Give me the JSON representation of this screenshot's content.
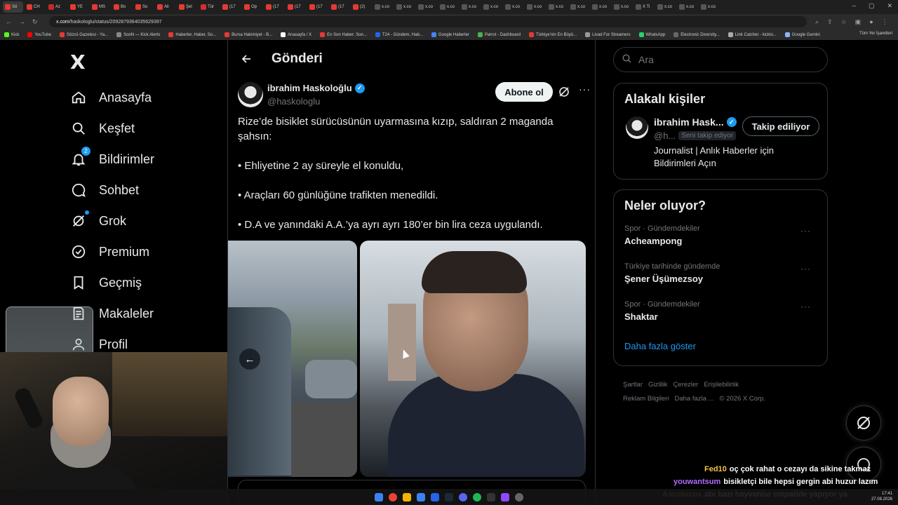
{
  "browser": {
    "tab_labels": [
      "Sö",
      "CH",
      "Az",
      "YE",
      "MS",
      "Bo",
      "So",
      "Ali",
      "Şel",
      "Tür",
      "(17",
      "Op",
      "(17",
      "(17",
      "(17",
      "(17",
      "(2)",
      "x.co",
      "x.co",
      "x.co",
      "x.co",
      "x.co",
      "x.co",
      "x.co",
      "x.co",
      "x.co",
      "x.co",
      "x.co",
      "x.co",
      "X Ti",
      "x.co",
      "x.co",
      "x.co"
    ],
    "url_host": "x.com",
    "url_path": "/haskologlu/status/2092879364035629397",
    "bookmarks": [
      "Kick",
      "YouTube",
      "Sözcü Gazetesi - Ya...",
      "SooN — Kick Alerts",
      "Haberler, Haber, So...",
      "Bursa Hakimiyet - B...",
      "Anasayfa / X",
      "En Son Haber: Son...",
      "T24 - Gündem, Hab...",
      "Google Haberler",
      "Parrot - Dashboard",
      "Türkiye'nin En Büyü...",
      "Livad For Streamers",
      "WhatsApp",
      "Electronic Diversity...",
      "Link Catcher - kicklo...",
      "Google Gemini"
    ],
    "bookmarks_right": "Tüm Yer İşaretleri"
  },
  "sidebar": {
    "logo": "X",
    "items": [
      {
        "label": "Anasayfa",
        "icon": "home-icon"
      },
      {
        "label": "Keşfet",
        "icon": "search-icon"
      },
      {
        "label": "Bildirimler",
        "icon": "bell-icon",
        "badge": "2"
      },
      {
        "label": "Sohbet",
        "icon": "chat-icon"
      },
      {
        "label": "Grok",
        "icon": "grok-icon"
      },
      {
        "label": "Premium",
        "icon": "premium-icon"
      },
      {
        "label": "Geçmiş",
        "icon": "bookmark-icon"
      },
      {
        "label": "Makaleler",
        "icon": "article-icon"
      },
      {
        "label": "Profil",
        "icon": "profile-icon"
      }
    ]
  },
  "main": {
    "header_title": "Gönderi",
    "author_name": "ibrahim Haskoloğlu",
    "author_handle": "@haskologlu",
    "subscribe_label": "Abone ol",
    "tweet_lines": [
      "Rize’de bisiklet sürücüsünün uyarmasına kızıp, saldıran 2 maganda şahsın:",
      "• Ehliyetine 2 ay süreyle el konuldu,",
      "• Araçları 60 günlüğüne trafikten menedildi.",
      "• D.A ve yanındaki A.A.’ya ayrı ayrı 180’er bin lira ceza uygulandı."
    ]
  },
  "right": {
    "search_placeholder": "Ara",
    "related_title": "Alakalı kişiler",
    "person_name": "ibrahim Hask...",
    "person_handle": "@h...",
    "follows_you": "Seni takip ediyor",
    "following_label": "Takip ediliyor",
    "person_bio": "Journalist | Anlık Haberler için Bildirimleri Açın",
    "trends_title": "Neler oluyor?",
    "trends": [
      {
        "category": "Spor · Gündemdekiler",
        "topic": "Acheampong"
      },
      {
        "category": "Türkiye tarihinde gündemde",
        "topic": "Şener Üşümezsoy"
      },
      {
        "category": "Spor · Gündemdekiler",
        "topic": "Shaktar"
      }
    ],
    "show_more": "Daha fazla göster",
    "footer": [
      "Şartlar",
      "Gizlilik",
      "Çerezler",
      "Erişilebilirlik",
      "Reklam Bilgileri",
      "Daha fazla ...",
      "© 2026 X Corp."
    ]
  },
  "chat": [
    {
      "user": "Fed10",
      "message": "oç çok rahat o cezayı da sikine takmaz",
      "color": "#f5c542"
    },
    {
      "user": "youwantsum",
      "message": "bisikletçi bile hepsi gergin abi huzur lazım",
      "color": "#b26cff"
    },
    {
      "user": "Ascotucos",
      "message": "abi bazı hayvanlar empatide yapıyor ya",
      "color": "#f5c542"
    }
  ],
  "clock": {
    "time": "17:41",
    "date": "27.08.2026"
  }
}
